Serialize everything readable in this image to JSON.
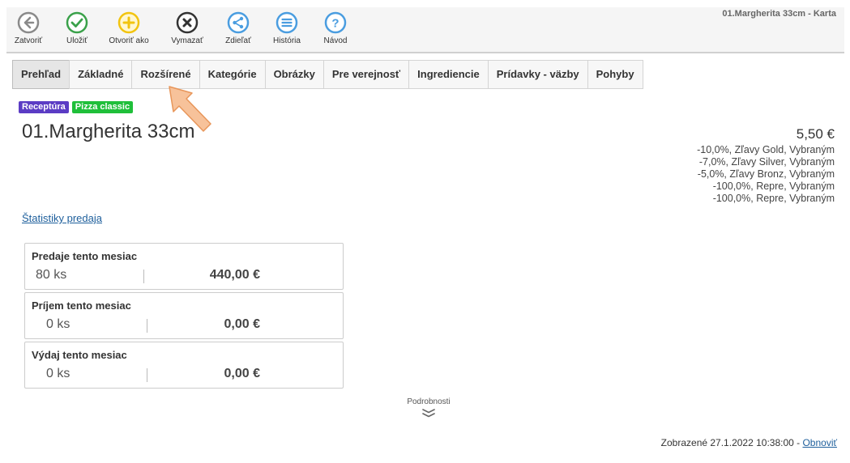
{
  "window": {
    "title": "01.Margherita 33cm - Karta"
  },
  "toolbar": {
    "items": [
      {
        "label": "Zatvoriť",
        "icon": "arrow-left-circle-icon",
        "color": "#8a8a8a"
      },
      {
        "label": "Uložiť",
        "icon": "check-circle-icon",
        "color": "#3aa14a"
      },
      {
        "label": "Otvoriť ako",
        "icon": "plus-circle-icon",
        "color": "#f2c40f"
      },
      {
        "label": "Vymazať",
        "icon": "x-circle-icon",
        "color": "#333333"
      },
      {
        "label": "Zdieľať",
        "icon": "share-circle-icon",
        "color": "#4a9de0"
      },
      {
        "label": "História",
        "icon": "list-circle-icon",
        "color": "#4a9de0"
      },
      {
        "label": "Návod",
        "icon": "help-circle-icon",
        "color": "#4a9de0"
      }
    ]
  },
  "tabs": [
    {
      "label": "Prehľad",
      "active": true
    },
    {
      "label": "Základné"
    },
    {
      "label": "Rozšírené"
    },
    {
      "label": "Kategórie"
    },
    {
      "label": "Obrázky"
    },
    {
      "label": "Pre verejnosť"
    },
    {
      "label": "Ingrediencie"
    },
    {
      "label": "Prídavky - väzby"
    },
    {
      "label": "Pohyby"
    }
  ],
  "badges": [
    {
      "label": "Receptúra",
      "color": "#5b3cc4"
    },
    {
      "label": "Pizza classic",
      "color": "#1fbf3a"
    }
  ],
  "product": {
    "title": "01.Margherita 33cm",
    "price": "5,50 €"
  },
  "discounts": [
    "-10,0%, Zľavy Gold, Vybraným",
    "-7,0%, Zľavy Silver, Vybraným",
    "-5,0%, Zľavy Bronz, Vybraným",
    "-100,0%, Repre, Vybraným",
    "-100,0%, Repre, Vybraným"
  ],
  "stats_link": "Štatistiky predaja",
  "cards": [
    {
      "title": "Predaje tento mesiac",
      "qty": "80 ks",
      "amount": "440,00 €"
    },
    {
      "title": "Príjem tento mesiac",
      "qty": "0 ks",
      "amount": "0,00 €"
    },
    {
      "title": "Výdaj tento mesiac",
      "qty": "0 ks",
      "amount": "0,00 €"
    }
  ],
  "details": {
    "label": "Podrobnosti",
    "icon": "double-chevron-down-icon"
  },
  "footer": {
    "displayed": "Zobrazené 27.1.2022 10:38:00 - ",
    "refresh": "Obnoviť"
  },
  "accent": {
    "link": "#1e5f9c",
    "arrow": "#f5b98a"
  }
}
